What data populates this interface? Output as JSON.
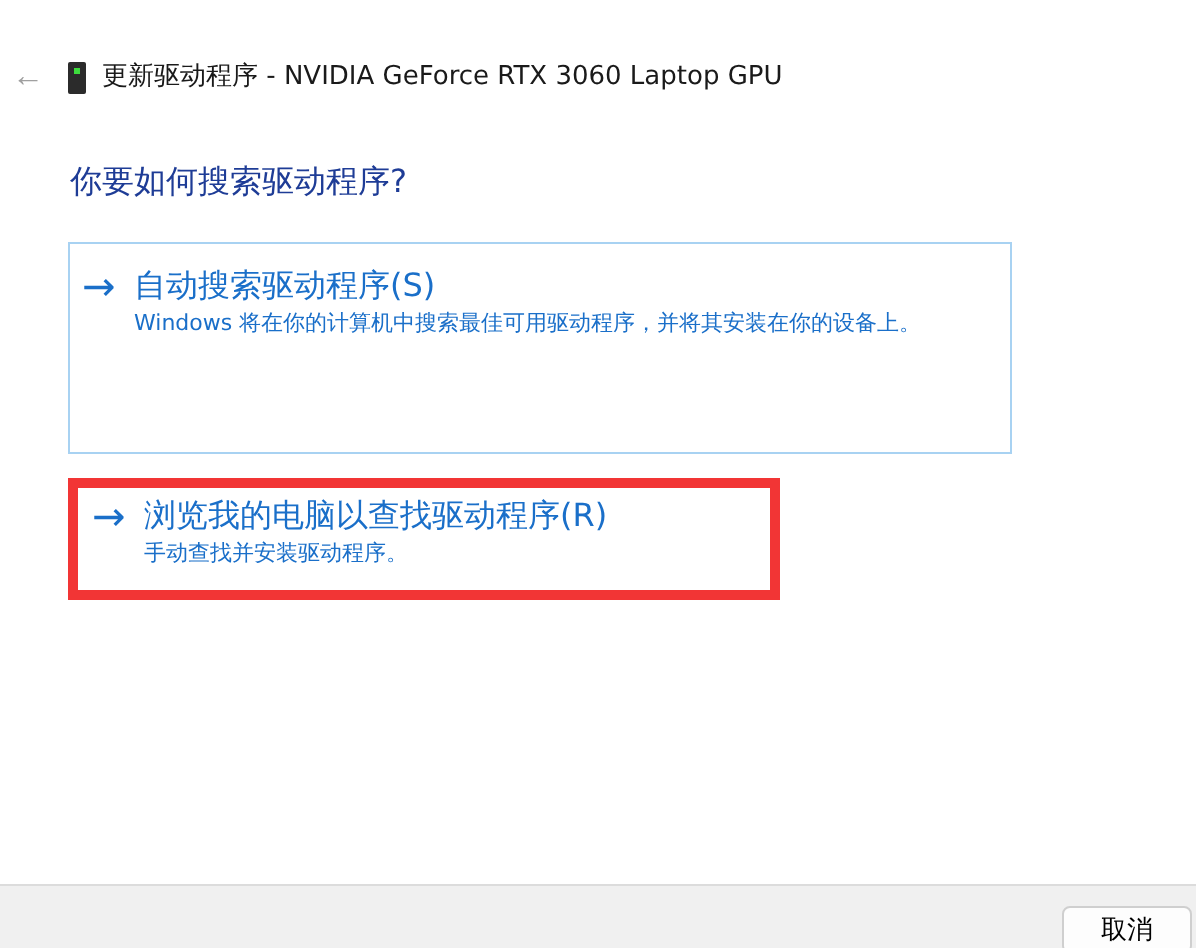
{
  "header": {
    "back": "←",
    "title": "更新驱动程序 - NVIDIA GeForce RTX 3060 Laptop GPU"
  },
  "question": "你要如何搜索驱动程序?",
  "options": [
    {
      "arrow": "→",
      "title": "自动搜索驱动程序(S)",
      "description": "Windows 将在你的计算机中搜索最佳可用驱动程序，并将其安装在你的设备上。",
      "selected": true,
      "highlighted": false
    },
    {
      "arrow": "→",
      "title": "浏览我的电脑以查找驱动程序(R)",
      "description": "手动查找并安装驱动程序。",
      "selected": false,
      "highlighted": true
    }
  ],
  "buttons": [
    "取消"
  ]
}
